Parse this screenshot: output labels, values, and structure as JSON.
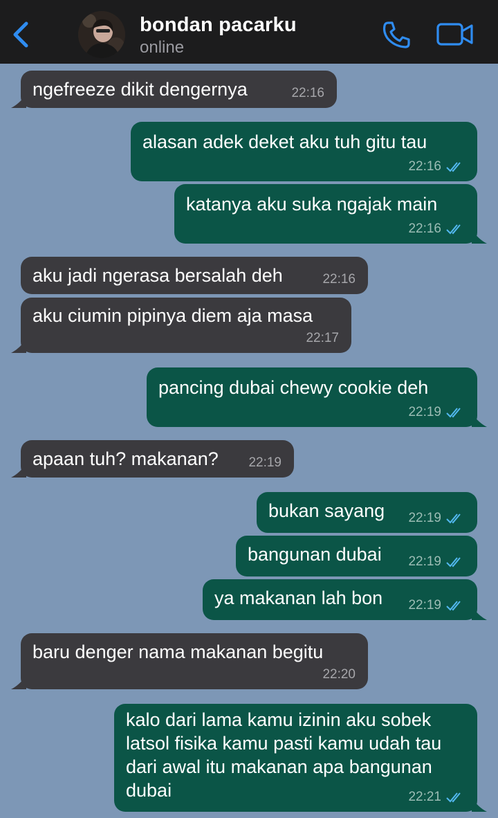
{
  "header": {
    "contact_name": "bondan pacarku",
    "status": "online"
  },
  "colors": {
    "header_bg": "#1c1c1d",
    "chat_bg": "#7d97b6",
    "incoming_bubble": "#3b3a3e",
    "outgoing_bubble": "#0b5547",
    "accent": "#2f8cf0",
    "read_ticks": "#53b8f0"
  },
  "icons": {
    "back": "chevron-left-icon",
    "call": "phone-icon",
    "video": "video-camera-icon",
    "read": "double-check-icon"
  },
  "messages": [
    {
      "direction": "in",
      "text": "ngefreeze dikit dengernya",
      "time": "22:16"
    },
    {
      "direction": "out",
      "text": "alasan adek deket aku tuh gitu tau",
      "time": "22:16",
      "read": true
    },
    {
      "direction": "out",
      "text": "katanya aku suka ngajak main",
      "time": "22:16",
      "read": true
    },
    {
      "direction": "in",
      "text": "aku jadi ngerasa bersalah deh",
      "time": "22:16"
    },
    {
      "direction": "in",
      "text": "aku ciumin pipinya diem aja masa",
      "time": "22:17"
    },
    {
      "direction": "out",
      "text": "pancing dubai chewy cookie deh",
      "time": "22:19",
      "read": true
    },
    {
      "direction": "in",
      "text": "apaan tuh? makanan?",
      "time": "22:19"
    },
    {
      "direction": "out",
      "text": "bukan sayang",
      "time": "22:19",
      "read": true
    },
    {
      "direction": "out",
      "text": "bangunan dubai",
      "time": "22:19",
      "read": true
    },
    {
      "direction": "out",
      "text": "ya makanan lah bon",
      "time": "22:19",
      "read": true
    },
    {
      "direction": "in",
      "text": "baru denger nama makanan begitu",
      "time": "22:20"
    },
    {
      "direction": "out",
      "text": "kalo dari lama kamu izinin aku sobek latsol fisika kamu pasti kamu udah tau dari awal itu makanan apa bangunan dubai",
      "time": "22:21",
      "read": true
    }
  ]
}
